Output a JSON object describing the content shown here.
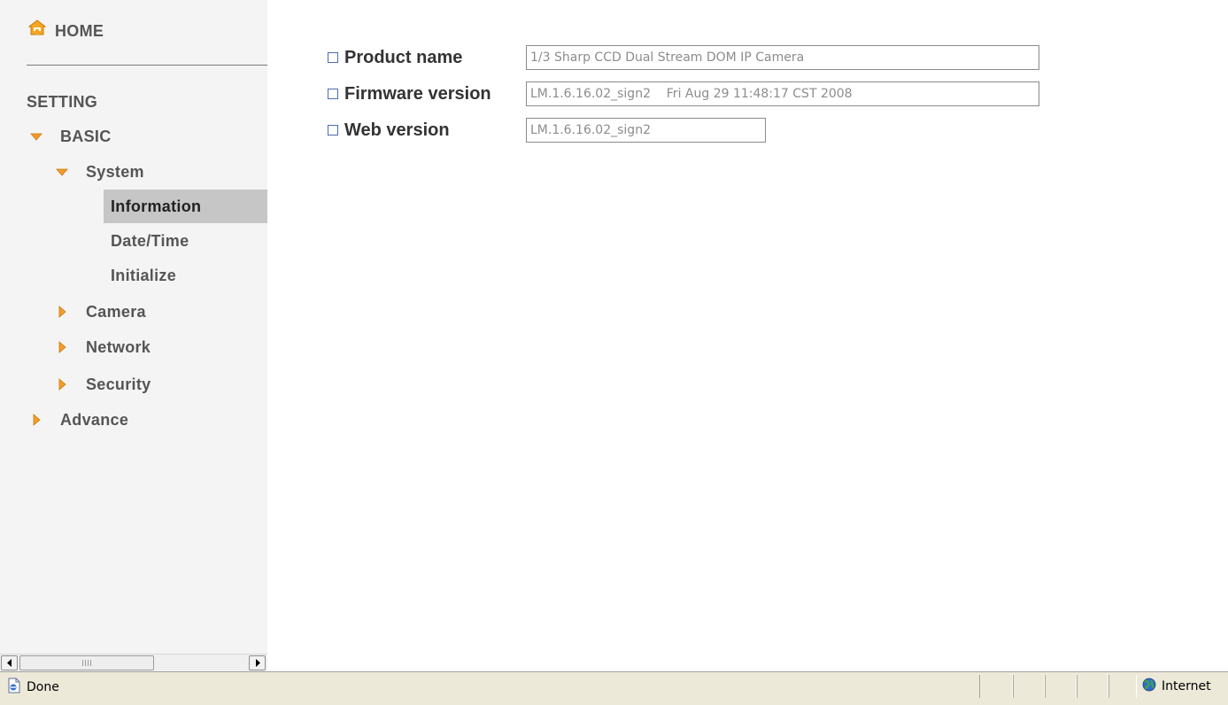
{
  "sidebar": {
    "home_label": "HOME",
    "setting_label": "SETTING",
    "basic_label": "BASIC",
    "system_label": "System",
    "information_label": "Information",
    "datetime_label": "Date/Time",
    "initialize_label": "Initialize",
    "camera_label": "Camera",
    "network_label": "Network",
    "security_label": "Security",
    "advance_label": "Advance",
    "selected_item": "Information"
  },
  "info": {
    "product_name_label": "Product name",
    "product_name_value": "1/3 Sharp CCD Dual Stream DOM IP Camera",
    "firmware_label": "Firmware version",
    "firmware_value": "LM.1.6.16.02_sign2    Fri Aug 29 11:48:17 CST 2008",
    "web_label": "Web version",
    "web_value": "LM.1.6.16.02_sign2"
  },
  "statusbar": {
    "status_text": "Done",
    "zone_text": "Internet"
  },
  "colors": {
    "arrow_orange": "#f39c2a",
    "selected_bg": "#c6c6c6",
    "bullet_blue": "#4b6cb7"
  },
  "icons": {
    "home": "home-icon",
    "expanded": "triangle-down-icon",
    "collapsed": "triangle-right-icon",
    "page": "ie-page-icon",
    "zone": "globe-icon"
  }
}
